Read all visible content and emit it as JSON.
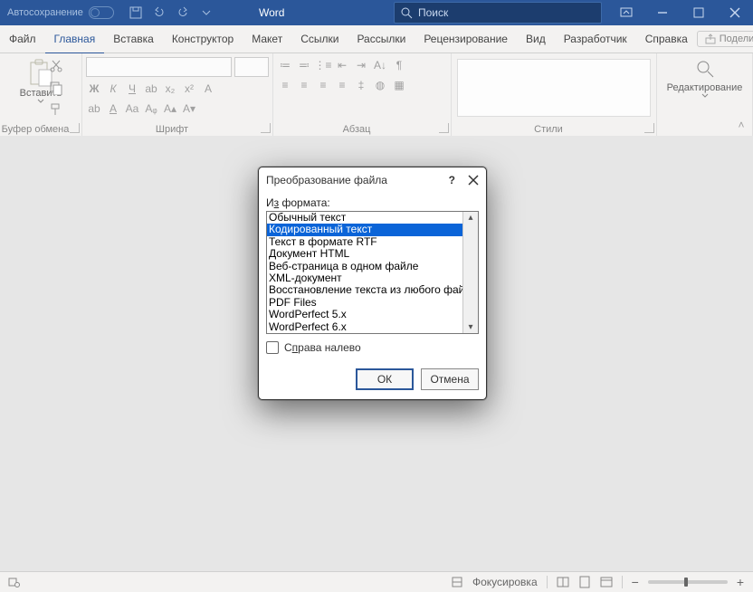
{
  "titlebar": {
    "autosave": "Автосохранение",
    "apptitle": "Word",
    "search_placeholder": "Поиск"
  },
  "menubar": {
    "tabs": [
      "Файл",
      "Главная",
      "Вставка",
      "Конструктор",
      "Макет",
      "Ссылки",
      "Рассылки",
      "Рецензирование",
      "Вид",
      "Разработчик",
      "Справка"
    ],
    "share": "Поделиться"
  },
  "ribbon": {
    "clipboard": {
      "paste": "Вставить",
      "label": "Буфер обмена"
    },
    "font_label": "Шрифт",
    "paragraph_label": "Абзац",
    "styles_label": "Стили",
    "editing": "Редактирование"
  },
  "statusbar": {
    "focus": "Фокусировка"
  },
  "dialog": {
    "title": "Преобразование файла",
    "from_label_pre": "И",
    "from_label_u": "з",
    "from_label_post": " формата:",
    "items": [
      "Обычный текст",
      "Кодированный текст",
      "Текст в формате RTF",
      "Документ HTML",
      "Веб-страница в одном файле",
      "XML-документ",
      "Восстановление текста из любого файла",
      "PDF Files",
      "WordPerfect 5.x",
      "WordPerfect 6.x"
    ],
    "rtl_pre": "С",
    "rtl_u": "п",
    "rtl_post": "рава налево",
    "ok": "ОК",
    "cancel": "Отмена"
  }
}
